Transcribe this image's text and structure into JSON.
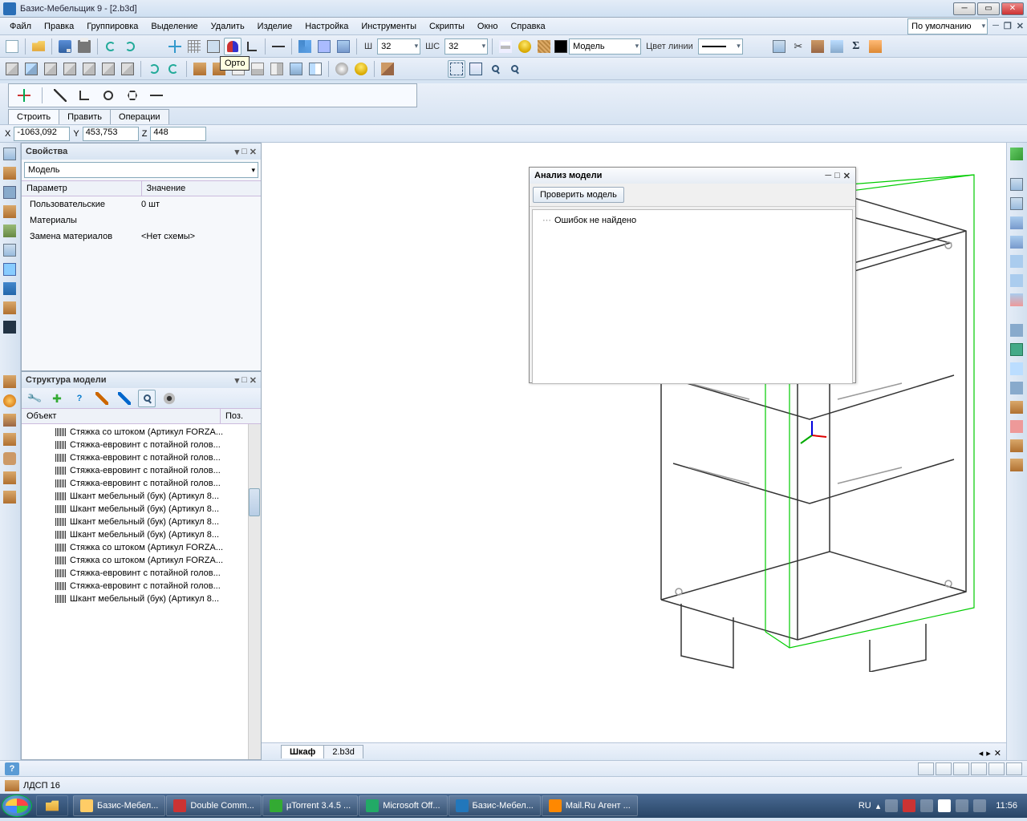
{
  "window": {
    "title": "Базис-Мебельщик 9 - [2.b3d]"
  },
  "menu": {
    "items": [
      "Файл",
      "Правка",
      "Группировка",
      "Выделение",
      "Удалить",
      "Изделие",
      "Настройка",
      "Инструменты",
      "Скрипты",
      "Окно",
      "Справка"
    ],
    "right": "По умолчанию"
  },
  "toolbar1": {
    "w_label": "Ш",
    "w_val": "32",
    "wc_label": "ШС",
    "wc_val": "32",
    "model_label": "Модель",
    "linecolor_label": "Цвет линии",
    "tooltip": "Орто"
  },
  "draw": {
    "tabs": [
      "Строить",
      "Править",
      "Операции"
    ]
  },
  "coords": {
    "x_label": "X",
    "x": "-1063,092",
    "y_label": "Y",
    "y": "453,753",
    "z_label": "Z",
    "z": "448"
  },
  "props": {
    "title": "Свойства",
    "combo": "Модель",
    "head_param": "Параметр",
    "head_value": "Значение",
    "rows": [
      {
        "n": "Пользовательские",
        "v": "0 шт"
      },
      {
        "n": "Материалы",
        "v": ""
      },
      {
        "n": "Замена материалов",
        "v": "<Нет схемы>"
      }
    ]
  },
  "struct": {
    "title": "Структура модели",
    "head_obj": "Объект",
    "head_pos": "Поз.",
    "items": [
      "Стяжка со штоком (Артикул FORZA...",
      "Стяжка-евровинт с потайной голов...",
      "Стяжка-евровинт с потайной голов...",
      "Стяжка-евровинт с потайной голов...",
      "Стяжка-евровинт с потайной голов...",
      "Шкант мебельный (бук) (Артикул 8...",
      "Шкант мебельный (бук) (Артикул 8...",
      "Шкант мебельный (бук) (Артикул 8...",
      "Шкант мебельный (бук) (Артикул 8...",
      "Стяжка со штоком (Артикул FORZA...",
      "Стяжка со штоком (Артикул FORZA...",
      "Стяжка-евровинт с потайной голов...",
      "Стяжка-евровинт с потайной голов...",
      "Шкант мебельный (бук) (Артикул 8..."
    ]
  },
  "dialog": {
    "title": "Анализ модели",
    "check_btn": "Проверить модель",
    "result": "Ошибок не найдено"
  },
  "viewtabs": {
    "tabs": [
      "Шкаф",
      "2.b3d"
    ]
  },
  "status2": {
    "material": "ЛДСП 16"
  },
  "taskbar": {
    "items": [
      "Базис-Мебел...",
      "Double Comm...",
      "µTorrent 3.4.5 ...",
      "Microsoft Off...",
      "Базис-Мебел...",
      "Mail.Ru Агент ..."
    ],
    "lang": "RU",
    "time": "11:56"
  }
}
